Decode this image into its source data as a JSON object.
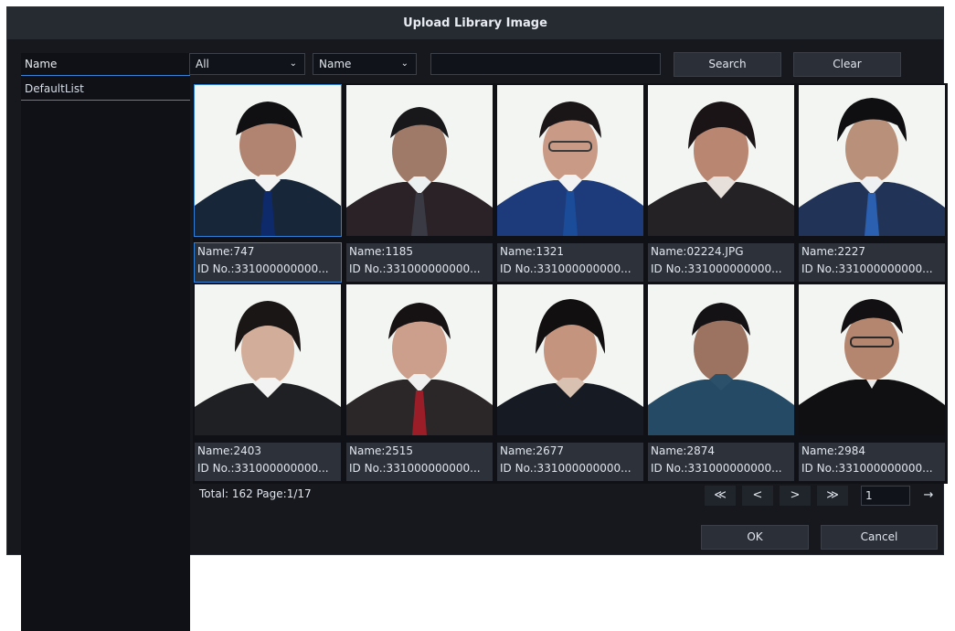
{
  "dialog": {
    "title": "Upload Library Image"
  },
  "sidebar": {
    "header": "Name",
    "items": [
      "DefaultList"
    ]
  },
  "filters": {
    "group_select": "All",
    "field_select": "Name",
    "search_value": "",
    "search_button": "Search",
    "clear_button": "Clear"
  },
  "cards": [
    {
      "name": "Name:747",
      "id": "ID No.:331000000000..."
    },
    {
      "name": "Name:1185",
      "id": "ID No.:331000000000..."
    },
    {
      "name": "Name:1321",
      "id": "ID No.:331000000000..."
    },
    {
      "name": "Name:02224.JPG",
      "id": "ID No.:331000000000..."
    },
    {
      "name": "Name:2227",
      "id": "ID No.:331000000000..."
    },
    {
      "name": "Name:2403",
      "id": "ID No.:331000000000..."
    },
    {
      "name": "Name:2515",
      "id": "ID No.:331000000000..."
    },
    {
      "name": "Name:2677",
      "id": "ID No.:331000000000..."
    },
    {
      "name": "Name:2874",
      "id": "ID No.:331000000000..."
    },
    {
      "name": "Name:2984",
      "id": "ID No.:331000000000..."
    }
  ],
  "footer": {
    "total": "Total: 162  Page:1/17",
    "page_input": "1",
    "first_icon": "double-left-chevron-icon",
    "prev_icon": "left-chevron-icon",
    "next_icon": "right-chevron-icon",
    "last_icon": "double-right-chevron-icon",
    "go_icon": "right-arrow-icon"
  },
  "buttons": {
    "ok": "OK",
    "cancel": "Cancel"
  },
  "colors": {
    "accent": "#2f80d6",
    "panel": "#16181e",
    "title": "#262a31"
  }
}
